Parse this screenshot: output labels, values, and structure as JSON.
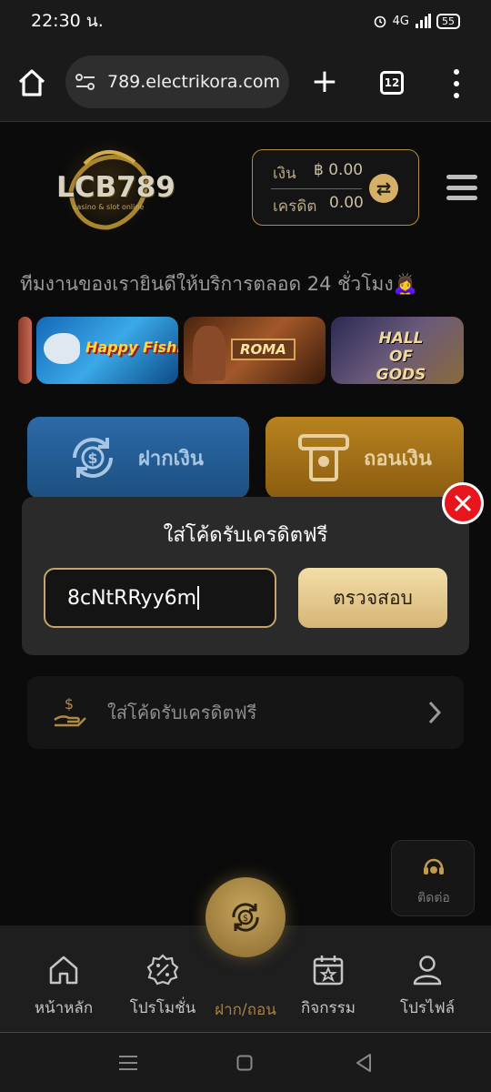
{
  "status_bar": {
    "time": "22:30 น.",
    "network": "4G",
    "battery": "55"
  },
  "browser": {
    "url": "789.electrikora.com",
    "tab_count": "12"
  },
  "header": {
    "logo_text": "LCB789",
    "logo_sub": "casino & slot online",
    "wallet": {
      "money_label": "เงิน",
      "money_value": "฿ 0.00",
      "credit_label": "เครดิต",
      "credit_value": "0.00"
    }
  },
  "marquee": "ทีมงานของเรายินดีให้บริการตลอด 24 ชั่วโมง🙇‍♀️",
  "banners": [
    {
      "title": ""
    },
    {
      "title": "Happy Fishing"
    },
    {
      "title": "ROMA"
    },
    {
      "title": "HALL OF GODS"
    }
  ],
  "actions": {
    "deposit": "ฝากเงิน",
    "withdraw": "ถอนเงิน"
  },
  "code_modal": {
    "title": "ใส่โค้ดรับเครดิตฟรี",
    "input_value": "8cNtRRyy6m",
    "check_button": "ตรวจสอบ"
  },
  "promo_row": {
    "label": "ใส่โค้ดรับเครดิตฟรี"
  },
  "contact": {
    "label": "ติดต่อ"
  },
  "bottom_nav": [
    {
      "label": "หน้าหลัก",
      "icon": "home-icon"
    },
    {
      "label": "โปรโมชั่น",
      "icon": "percent-badge-icon"
    },
    {
      "label": "ฝาก/ถอน",
      "icon": "exchange-icon",
      "active": true
    },
    {
      "label": "กิจกรรม",
      "icon": "calendar-star-icon"
    },
    {
      "label": "โปรไฟล์",
      "icon": "user-icon"
    }
  ],
  "colors": {
    "accent_gold": "#c6a56a",
    "deposit_blue": "#2c6aa8",
    "withdraw_gold": "#b8831f",
    "close_red": "#e8151d"
  }
}
